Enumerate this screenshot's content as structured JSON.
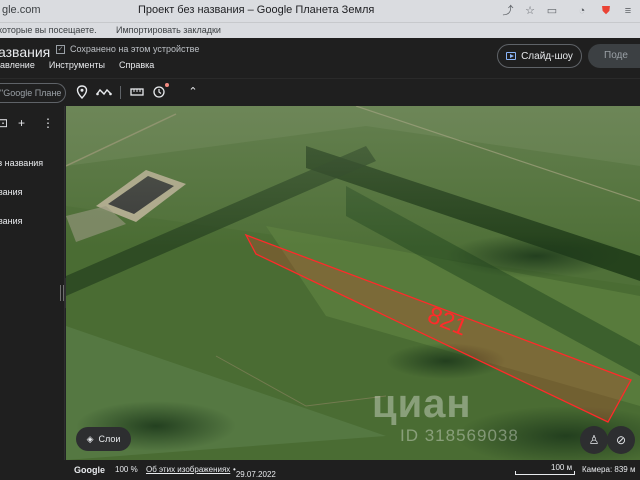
{
  "browser": {
    "url": "gle.com",
    "tab_title": "Проект без названия – Google Планета Земля",
    "bookmarks": [
      "которые вы посещаете.",
      "Импортировать закладки"
    ]
  },
  "header": {
    "title": "азвания",
    "saved_status": "Сохранено на этом устройстве",
    "slideshow_label": "Слайд-шоу",
    "share_label": "Поде"
  },
  "menu": [
    "авление",
    "Инструменты",
    "Справка"
  ],
  "toolbar": {
    "search_placeholder": "\"Google Плане",
    "icons": [
      "placemark-icon",
      "path-icon",
      "ruler-icon",
      "history-icon",
      "chevron-up-icon"
    ]
  },
  "sidebar": {
    "projects": [
      "з названия",
      "вания",
      "вания"
    ]
  },
  "map": {
    "parcel_label": "821",
    "parcel_color": "#ff2a2a",
    "watermark": "циан",
    "watermark_id": "ID 318569038"
  },
  "controls": {
    "layers_label": "Слои"
  },
  "status": {
    "brand": "Google",
    "zoom": "100 %",
    "about_images": "Об этих изображениях",
    "date": "29.07.2022",
    "scale": "100 м",
    "camera": "Камера: 839 м"
  }
}
